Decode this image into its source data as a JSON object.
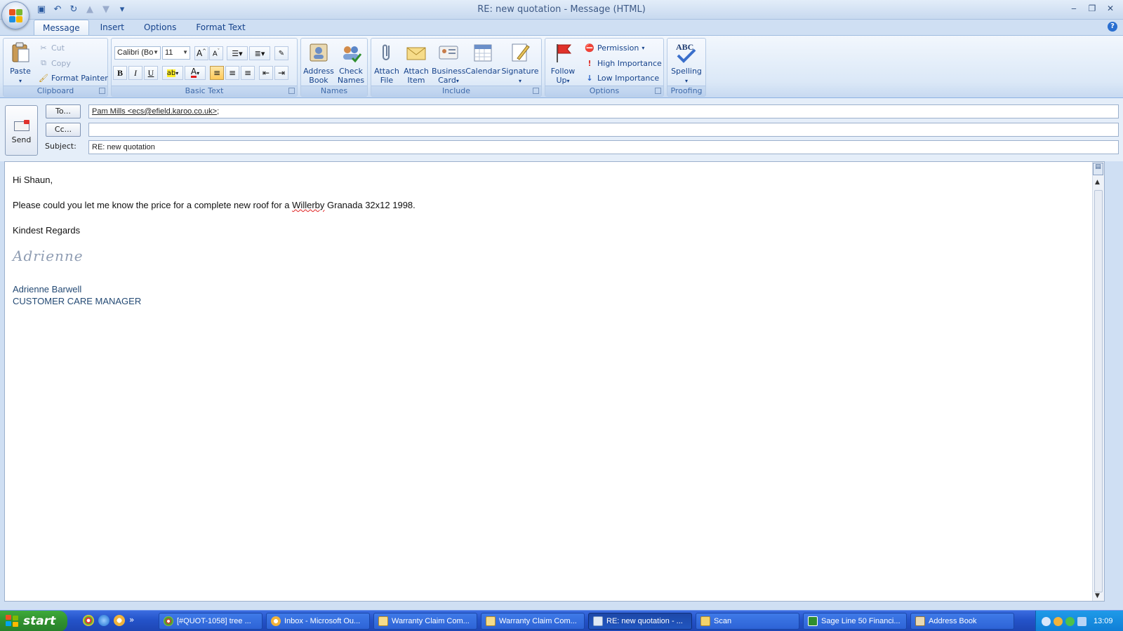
{
  "window": {
    "title": "RE: new quotation - Message (HTML)"
  },
  "qat": {
    "customize": "▾"
  },
  "tabs": [
    "Message",
    "Insert",
    "Options",
    "Format Text"
  ],
  "ribbon": {
    "clipboard": {
      "label": "Clipboard",
      "paste": "Paste",
      "cut": "Cut",
      "copy": "Copy",
      "format_painter": "Format Painter"
    },
    "basic_text": {
      "label": "Basic Text",
      "font": "Calibri (Bo",
      "size": "11"
    },
    "names": {
      "label": "Names",
      "address_book_1": "Address",
      "address_book_2": "Book",
      "check_names_1": "Check",
      "check_names_2": "Names"
    },
    "include": {
      "label": "Include",
      "attach_file_1": "Attach",
      "attach_file_2": "File",
      "attach_item_1": "Attach",
      "attach_item_2": "Item",
      "business_card_1": "Business",
      "business_card_2": "Card",
      "calendar": "Calendar",
      "signature": "Signature"
    },
    "options": {
      "label": "Options",
      "follow_up_1": "Follow",
      "follow_up_2": "Up",
      "permission": "Permission",
      "high_importance": "High Importance",
      "low_importance": "Low Importance"
    },
    "proofing": {
      "label": "Proofing",
      "abc": "ABC",
      "spelling": "Spelling"
    }
  },
  "header": {
    "send": "Send",
    "to_button": "To...",
    "cc_button": "Cc...",
    "subject_label": "Subject:",
    "to_value": "Pam Mills <ecs@efield.karoo.co.uk>",
    "to_suffix": ";",
    "cc_value": "",
    "subject_value": "RE: new quotation"
  },
  "body": {
    "greeting": "Hi Shaun,",
    "line_pre": "Please could you let me know the price for a complete new roof for a ",
    "line_misspelled": "Willerby",
    "line_post": " Granada 32x12 1998.",
    "closing": "Kindest Regards",
    "signature_script": "Adrienne",
    "sig_name": "Adrienne Barwell",
    "sig_title": "CUSTOMER CARE MANAGER"
  },
  "taskbar": {
    "start": "start",
    "chevron": "»",
    "buttons": [
      "[#QUOT-1058] tree ...",
      "Inbox - Microsoft Ou...",
      "Warranty Claim Com...",
      "Warranty Claim Com...",
      "RE: new quotation - ...",
      "Scan",
      "Sage Line 50 Financi...",
      "Address Book"
    ],
    "clock": "13:09"
  },
  "colors": {
    "accent": "#15428b",
    "taskbar": "#245edb",
    "start": "#2f8e2e",
    "squiggle": "#e02020"
  }
}
